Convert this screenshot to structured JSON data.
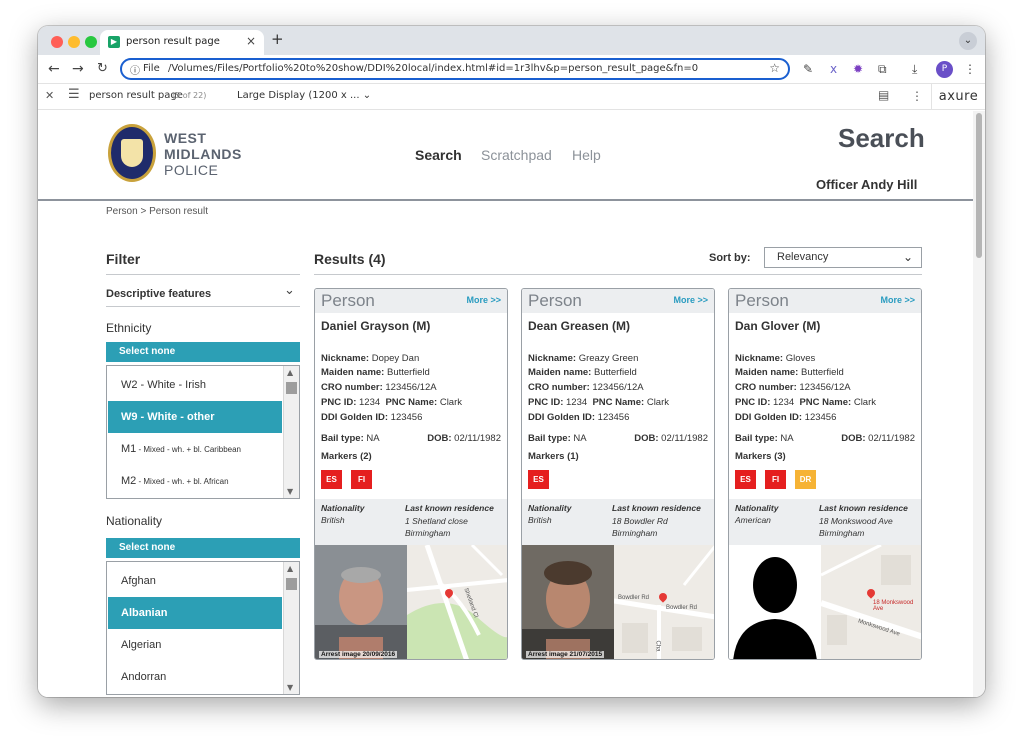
{
  "browser": {
    "tab_title": "person result page",
    "url_scheme": "File",
    "url": "/Volumes/Files/Portfolio%20to%20show/DDI%20local/index.html#id=1r3lhv&p=person_result_page&fn=0",
    "avatar_letter": "P"
  },
  "axure": {
    "page_name": "person result page",
    "page_count": "(5 of 22)",
    "display": "Large Display (1200 x ...",
    "brand": "axure"
  },
  "header": {
    "logo_line1": "WEST",
    "logo_line2": "MIDLANDS",
    "logo_line3": "POLICE",
    "nav": [
      "Search",
      "Scratchpad",
      "Help"
    ],
    "title": "Search",
    "officer": "Officer Andy Hill"
  },
  "breadcrumb": "Person  >  Person result",
  "filter": {
    "title": "Filter",
    "section": "Descriptive features",
    "ethnicity_label": "Ethnicity",
    "nationality_label": "Nationality",
    "select_none": "Select none",
    "ethnicity_items": [
      {
        "code": "W2 - White - Irish",
        "sub": ""
      },
      {
        "code": "W9 - White - other",
        "sub": ""
      },
      {
        "code": "M1",
        "sub": " - Mixed - wh. + bl. Caribbean"
      },
      {
        "code": "M2",
        "sub": " - Mixed - wh. + bl. African"
      }
    ],
    "nationality_items": [
      "Afghan",
      "Albanian",
      "Algerian",
      "Andorran"
    ]
  },
  "results": {
    "title": "Results (4)",
    "sort_label": "Sort by:",
    "sort_value": "Relevancy",
    "labels": {
      "type": "Person",
      "more": "More >>",
      "nickname": "Nickname:",
      "maiden": "Maiden name:",
      "cro": "CRO number:",
      "pnc_id": "PNC ID:",
      "pnc_name": "PNC Name:",
      "golden": "DDI Golden ID:",
      "bail": "Bail type:",
      "dob": "DOB:",
      "nationality": "Nationality",
      "residence": "Last known residence"
    },
    "cards": [
      {
        "name": "Daniel Grayson (M)",
        "nickname": "Dopey Dan",
        "maiden": "Butterfield",
        "cro": "123456/12A",
        "pnc_id": "1234",
        "pnc_name": "Clark",
        "golden": "123456",
        "bail": "NA",
        "dob": "02/11/1982",
        "markers": "Markers (2)",
        "badges": [
          "ES",
          "FI"
        ],
        "nationality": "British",
        "res1": "1 Shetland close",
        "res2": "Birmingham",
        "caption": "Arrest image 20/09/2016"
      },
      {
        "name": "Dean Greasen (M)",
        "nickname": "Greazy Green",
        "maiden": "Butterfield",
        "cro": "123456/12A",
        "pnc_id": "1234",
        "pnc_name": "Clark",
        "golden": "123456",
        "bail": "NA",
        "dob": "02/11/1982",
        "markers": "Markers (1)",
        "badges": [
          "ES"
        ],
        "nationality": "British",
        "res1": "18 Bowdler Rd",
        "res2": "Birmingham",
        "caption": "Arrest image 21/07/2015"
      },
      {
        "name": "Dan Glover (M)",
        "nickname": "Gloves",
        "maiden": "Butterfield",
        "cro": "123456/12A",
        "pnc_id": "1234",
        "pnc_name": "Clark",
        "golden": "123456",
        "bail": "NA",
        "dob": "02/11/1982",
        "markers": "Markers (3)",
        "badges": [
          "ES",
          "FI",
          "DR"
        ],
        "nationality": "American",
        "res1": "18 Monkswood Ave",
        "res2": "Birmingham",
        "caption": ""
      }
    ],
    "map_labels": {
      "c1": [
        "Shetland Cl"
      ],
      "c2": [
        "Bowdler Rd",
        "Bowdler Rd",
        "Cha"
      ],
      "c3": [
        "18 Monkswood Ave",
        "Monkswood Ave"
      ]
    }
  },
  "colors": {
    "accent": "#2c9fb5",
    "marker_red": "#e51f1f",
    "marker_amber": "#f6b335",
    "link": "#2a9cc0"
  }
}
